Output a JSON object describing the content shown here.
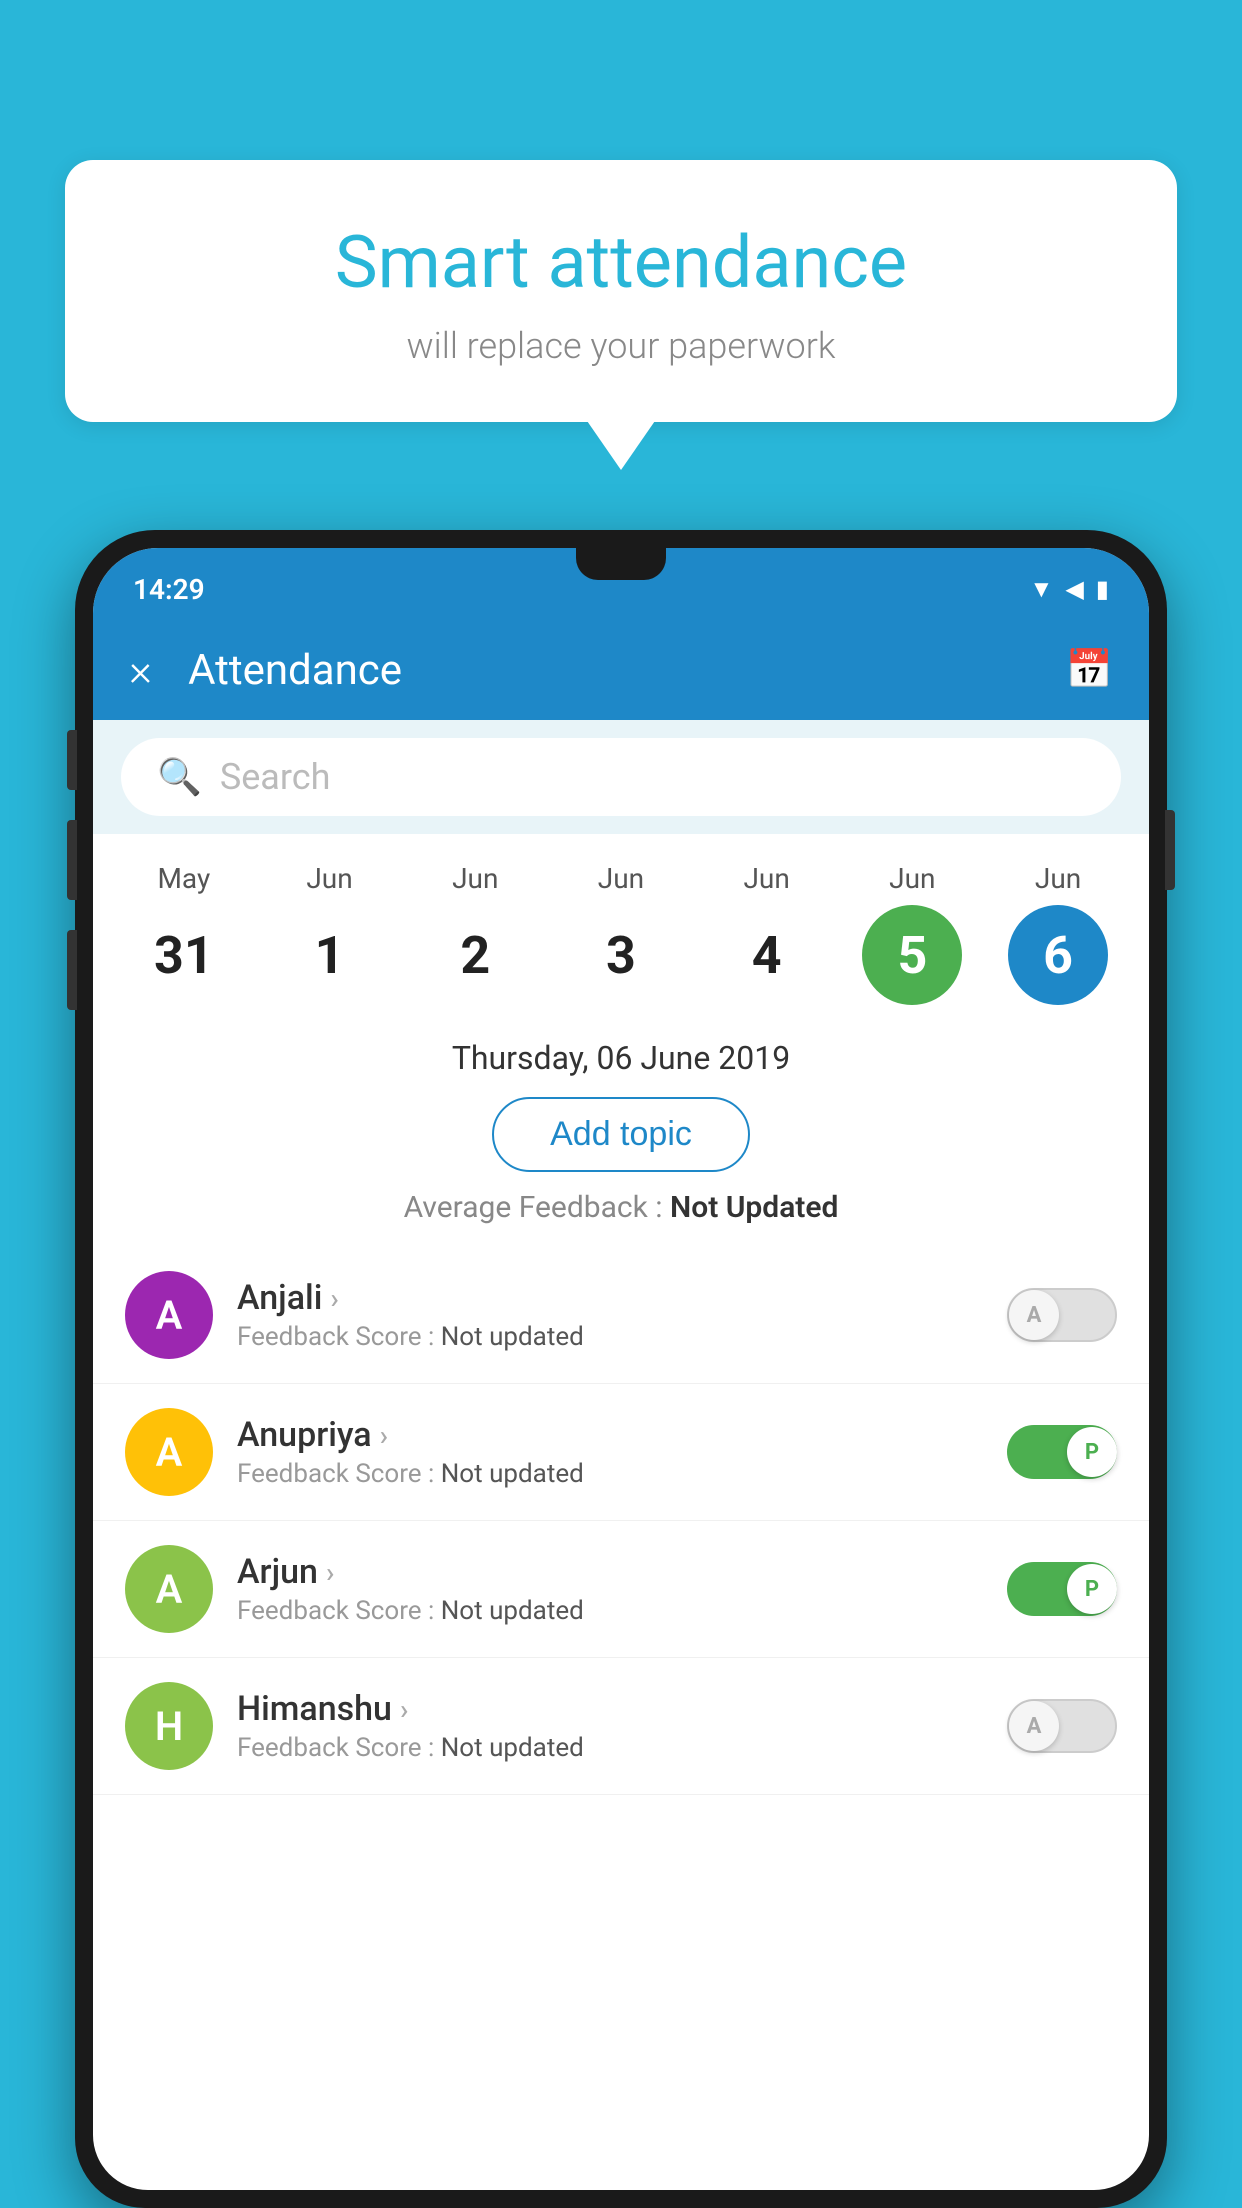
{
  "background_color": "#29b6d8",
  "bubble": {
    "title": "Smart attendance",
    "subtitle": "will replace your paperwork"
  },
  "app": {
    "status_time": "14:29",
    "title": "Attendance",
    "close_label": "×",
    "search_placeholder": "Search",
    "selected_date_label": "Thursday, 06 June 2019",
    "add_topic_label": "Add topic",
    "avg_feedback_label": "Average Feedback : ",
    "avg_feedback_value": "Not Updated"
  },
  "calendar": [
    {
      "month": "May",
      "date": "31",
      "state": "normal"
    },
    {
      "month": "Jun",
      "date": "1",
      "state": "normal"
    },
    {
      "month": "Jun",
      "date": "2",
      "state": "normal"
    },
    {
      "month": "Jun",
      "date": "3",
      "state": "normal"
    },
    {
      "month": "Jun",
      "date": "4",
      "state": "normal"
    },
    {
      "month": "Jun",
      "date": "5",
      "state": "today"
    },
    {
      "month": "Jun",
      "date": "6",
      "state": "selected"
    }
  ],
  "students": [
    {
      "name": "Anjali",
      "avatar_letter": "A",
      "avatar_color": "#9c27b0",
      "feedback": "Not updated",
      "toggle_state": "off",
      "toggle_label": "A"
    },
    {
      "name": "Anupriya",
      "avatar_letter": "A",
      "avatar_color": "#ffc107",
      "feedback": "Not updated",
      "toggle_state": "on",
      "toggle_label": "P"
    },
    {
      "name": "Arjun",
      "avatar_letter": "A",
      "avatar_color": "#8bc34a",
      "feedback": "Not updated",
      "toggle_state": "on",
      "toggle_label": "P"
    },
    {
      "name": "Himanshu",
      "avatar_letter": "H",
      "avatar_color": "#8bc34a",
      "feedback": "Not updated",
      "toggle_state": "off",
      "toggle_label": "A"
    }
  ],
  "icons": {
    "wifi": "▲",
    "signal": "▲",
    "battery": "▮",
    "calendar": "📅",
    "search": "🔍",
    "chevron": "›"
  }
}
